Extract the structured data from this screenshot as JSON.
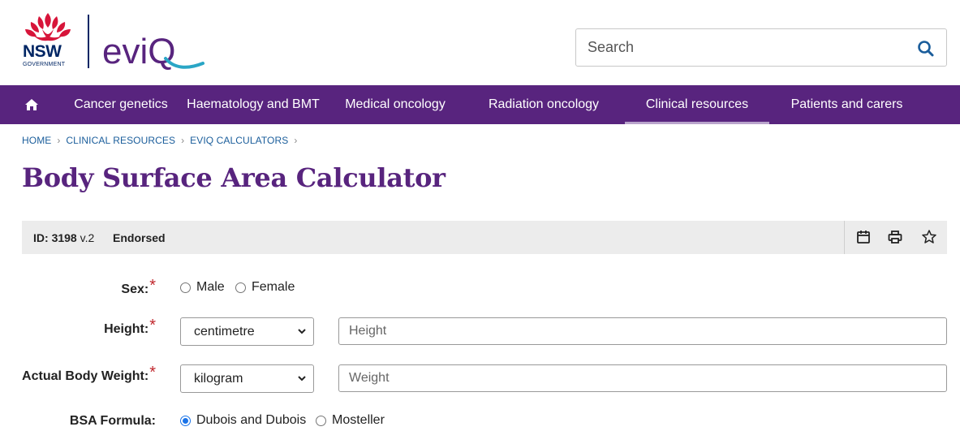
{
  "header": {
    "nsw_text": "NSW",
    "gov_text": "GOVERNMENT",
    "eviq_text": "eviQ",
    "search_placeholder": "Search"
  },
  "nav": {
    "items": [
      {
        "label": "Cancer genetics",
        "active": false
      },
      {
        "label": "Haematology and BMT",
        "active": false
      },
      {
        "label": "Medical oncology",
        "active": false
      },
      {
        "label": "Radiation oncology",
        "active": false
      },
      {
        "label": "Clinical resources",
        "active": true
      },
      {
        "label": "Patients and carers",
        "active": false
      }
    ]
  },
  "breadcrumb": {
    "items": [
      "HOME",
      "CLINICAL RESOURCES",
      "EVIQ CALCULATORS"
    ]
  },
  "page_title": "Body Surface Area Calculator",
  "infobar": {
    "id_label": "ID:",
    "id_value": "3198",
    "version": "v.2",
    "status": "Endorsed",
    "tools": [
      "calendar-icon",
      "print-icon",
      "star-icon"
    ]
  },
  "form": {
    "sex": {
      "label": "Sex:",
      "options": [
        "Male",
        "Female"
      ],
      "selected": null
    },
    "height": {
      "label": "Height:",
      "unit": "centimetre",
      "placeholder": "Height"
    },
    "weight": {
      "label": "Actual Body Weight:",
      "unit": "kilogram",
      "placeholder": "Weight"
    },
    "bsa_formula": {
      "label": "BSA Formula:",
      "options": [
        "Dubois and Dubois",
        "Mosteller"
      ],
      "selected": "Dubois and Dubois"
    },
    "required_mark": "*"
  },
  "colors": {
    "brand_purple": "#58247e",
    "nsw_red": "#d7153a",
    "nsw_navy": "#002664",
    "eviq_teal": "#2aa6c6",
    "link_blue": "#1a5d9b",
    "required_red": "#c0272d"
  }
}
